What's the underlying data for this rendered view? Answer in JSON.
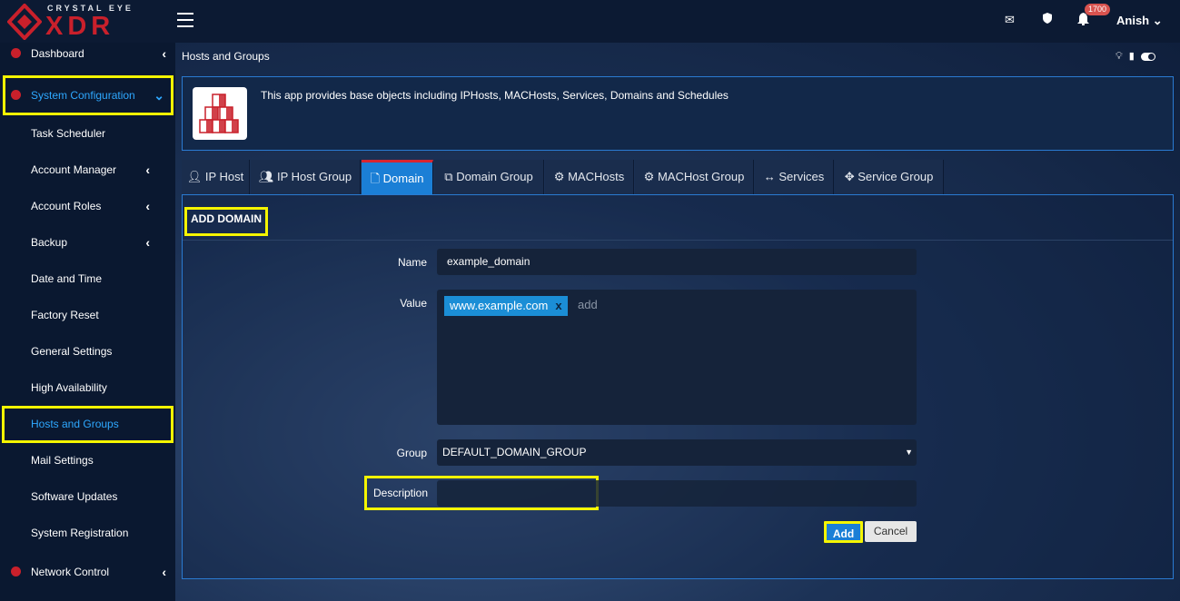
{
  "brand": {
    "small": "CRYSTAL EYE",
    "big": "XDR"
  },
  "topbar": {
    "notification_count": "1700",
    "user": "Anish"
  },
  "sidebar": {
    "items": [
      {
        "label": "Dashboard"
      },
      {
        "label": "System Configuration"
      },
      {
        "label": "Task Scheduler"
      },
      {
        "label": "Account Manager"
      },
      {
        "label": "Account Roles"
      },
      {
        "label": "Backup"
      },
      {
        "label": "Date and Time"
      },
      {
        "label": "Factory Reset"
      },
      {
        "label": "General Settings"
      },
      {
        "label": "High Availability"
      },
      {
        "label": "Hosts and Groups"
      },
      {
        "label": "Mail Settings"
      },
      {
        "label": "Software Updates"
      },
      {
        "label": "System Registration"
      },
      {
        "label": "Network Control"
      }
    ]
  },
  "page": {
    "title": "Hosts and Groups",
    "info": "This app provides base objects including IPHosts, MACHosts, Services, Domains and Schedules"
  },
  "tabs": [
    {
      "label": "IP Host"
    },
    {
      "label": "IP Host Group"
    },
    {
      "label": "Domain"
    },
    {
      "label": "Domain Group"
    },
    {
      "label": "MACHosts"
    },
    {
      "label": "MACHost Group"
    },
    {
      "label": "Services"
    },
    {
      "label": "Service Group"
    }
  ],
  "form": {
    "title": "ADD DOMAIN",
    "name_label": "Name",
    "name_value": "example_domain",
    "value_label": "Value",
    "value_tag": "www.example.com",
    "value_tag_remove": "x",
    "value_placeholder": "add",
    "group_label": "Group",
    "group_value": "DEFAULT_DOMAIN_GROUP",
    "description_label": "Description",
    "description_value": "",
    "add_button": "Add",
    "cancel_button": "Cancel"
  },
  "colors": {
    "accent": "#1b7fd6",
    "brand_red": "#c9202b",
    "highlight": "#f5f500"
  }
}
